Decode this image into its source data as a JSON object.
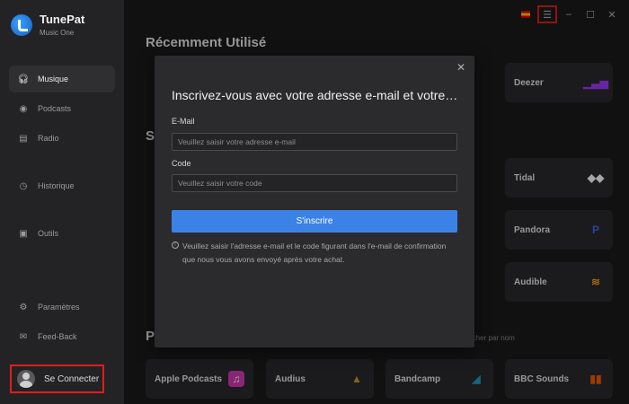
{
  "app": {
    "name": "TunePat",
    "subtitle": "Music One"
  },
  "sidebar": {
    "items": [
      {
        "label": "Musique",
        "icon": "headphones-icon"
      },
      {
        "label": "Podcasts",
        "icon": "podcast-icon"
      },
      {
        "label": "Radio",
        "icon": "radio-icon"
      },
      {
        "label": "Historique",
        "icon": "history-icon"
      },
      {
        "label": "Outils",
        "icon": "toolbox-icon"
      },
      {
        "label": "Paramètres",
        "icon": "gear-icon"
      },
      {
        "label": "Feed-Back",
        "icon": "mail-icon"
      }
    ],
    "login_label": "Se Connecter"
  },
  "main": {
    "recent_title": "Récemment Utilisé",
    "section_s_initial": "S",
    "section_p_initial": "P",
    "search_placeholder": "rcher par nom",
    "cards": [
      {
        "label": "Deezer",
        "icon": "deezer-icon",
        "color": "#a238ff"
      },
      {
        "label": "Tidal",
        "icon": "tidal-icon",
        "color": "#ffffff"
      },
      {
        "label": "Pandora",
        "icon": "pandora-icon",
        "color": "#3668ff"
      },
      {
        "label": "Audible",
        "icon": "audible-icon",
        "color": "#f7991c"
      },
      {
        "label": "Apple Podcasts",
        "icon": "apple-podcasts-icon",
        "color": "#d33ab6"
      },
      {
        "label": "Audius",
        "icon": "audius-icon",
        "color": "#cc9a2e"
      },
      {
        "label": "Bandcamp",
        "icon": "bandcamp-icon",
        "color": "#1da0c3"
      },
      {
        "label": "BBC Sounds",
        "icon": "bbc-sounds-icon",
        "color": "#f55a00"
      }
    ]
  },
  "modal": {
    "title": "Inscrivez-vous avec votre adresse e-mail et votre c...",
    "email_label": "E-Mail",
    "email_placeholder": "Veuillez saisir votre adresse e-mail",
    "code_label": "Code",
    "code_placeholder": "Veuillez saisir votre code",
    "submit_label": "S'inscrire",
    "info_text": "Veuillez saisir l'adresse e-mail et le code figurant dans l'e-mail de confirmation que nous vous avons envoyé après votre achat.",
    "close_glyph": "✕"
  },
  "window_controls": {
    "menu": "☰",
    "minimize": "–",
    "maximize": "☐",
    "close": "✕"
  }
}
